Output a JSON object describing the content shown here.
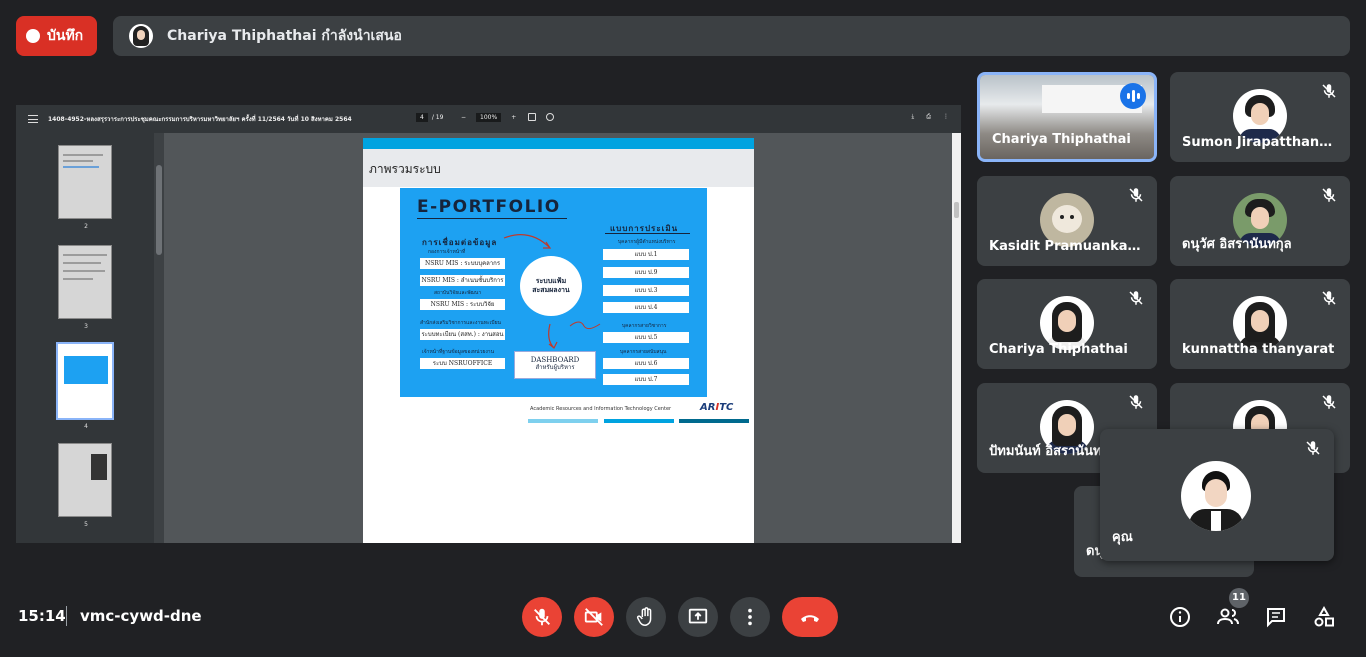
{
  "record": {
    "label": "บันทึก"
  },
  "banner": {
    "text": "Chariya Thiphathai กำลังนำเสนอ"
  },
  "pdf": {
    "title": "1408-4952-หลงสรุรวาระการประชุมคณะกรรมการบริหารมหาวิทยาลัยฯ ครั้งที่ 11/2564 วันที่ 10 สิงหาคม 2564",
    "page_current": "4",
    "page_sep": "/ 19",
    "zoom": "100%",
    "thumb_numbers": [
      "2",
      "3",
      "4",
      "5"
    ],
    "slide": {
      "heading": "ภาพรวมระบบ",
      "title": "E-PORTFOLIO",
      "left_head": "การเชื่อมต่อข้อมูล",
      "left_sub1": "กองการเจ้าหน้าที่",
      "box1": "NSRU MIS : ระบบบุคลากร",
      "box2": "NSRU MIS : ลำเนนชั้นบริการ",
      "left_sub2": "สถาบันวิจัยและพัฒนา",
      "box3": "NSRU MIS : ระบบวิจัย",
      "left_sub3": "สำนักส่งเสริมวิชาการและงานทะเบียน",
      "box4": "ระบบทะเบียน (สสท.) : งานสอน",
      "left_sub4": "เจ้าหน้าที่ฐานข้อมูลของหน่วยงาน",
      "box5": "ระบบ NSRUOFFICE",
      "center_line1": "ระบบแฟ้ม",
      "center_line2": "สะสมผลงาน",
      "dash_line1": "DASHBOARD",
      "dash_line2": "สำหรับผู้บริหาร",
      "right_head": "แบบการประเมิน",
      "right_sub1": "บุคลากรผู้มีตำแหน่งบริหาร",
      "r1": "แบบ ป.1",
      "r2": "แบบ ป.9",
      "r3": "แบบ ป.3",
      "r4": "แบบ ป.4",
      "right_sub2": "บุคลากรสายวิชาการ",
      "r5": "แบบ ป.5",
      "right_sub3": "บุคลากรสายสนับสนุน",
      "r6": "แบบ ป.6",
      "r7": "แบบ ป.7",
      "footer": "Academic Resources and Information Technology Center",
      "logo": "ARITC"
    }
  },
  "participants": [
    {
      "name": "Chariya Thiphathai",
      "state": "speaking"
    },
    {
      "name": "Sumon Jirapatthanaporn",
      "state": "muted"
    },
    {
      "name": "Kasidit Pramuankamon",
      "state": "muted"
    },
    {
      "name": "ดนุวัศ อิสรานันทกุล",
      "state": "muted"
    },
    {
      "name": "Chariya Thiphathai",
      "state": "muted"
    },
    {
      "name": "kunnattha thanyarat",
      "state": "muted"
    },
    {
      "name": "ปัทมนันท์ อิสรานันทกุล",
      "state": "muted"
    },
    {
      "name": "",
      "state": "muted"
    }
  ],
  "under_tile_name": "ดนุ",
  "self_tile": {
    "name": "คุณ"
  },
  "bottom": {
    "time": "15:14",
    "meeting_code": "vmc-cywd-dne",
    "people_count": "11"
  },
  "colors": {
    "accent_red": "#ea4335",
    "accent_blue": "#1a73e8",
    "slide_blue": "#1da1f2"
  }
}
